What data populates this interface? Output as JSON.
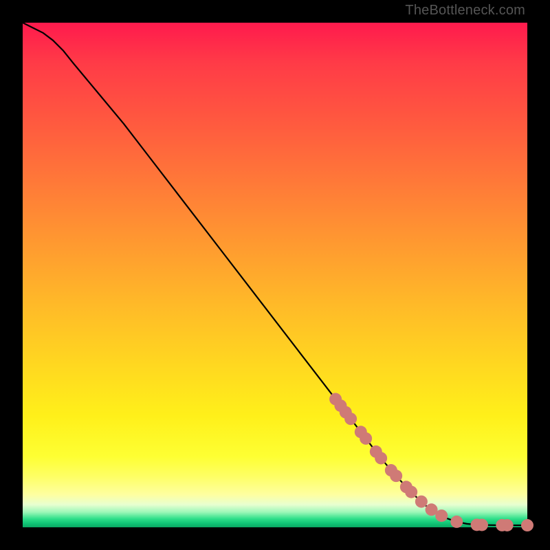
{
  "watermark": "TheBottleneck.com",
  "colors": {
    "curve": "#000000",
    "marker_fill": "#cf7a76",
    "marker_stroke": "#b86864"
  },
  "chart_data": {
    "type": "line",
    "title": "",
    "xlabel": "",
    "ylabel": "",
    "xlim": [
      0,
      100
    ],
    "ylim": [
      0,
      100
    ],
    "grid": false,
    "series": [
      {
        "name": "curve",
        "x": [
          0,
          2,
          4,
          6,
          8,
          10,
          15,
          20,
          25,
          30,
          35,
          40,
          45,
          50,
          55,
          60,
          62,
          64,
          66,
          68,
          70,
          72,
          74,
          76,
          78,
          80,
          82,
          84,
          86,
          88,
          90,
          92,
          94,
          96,
          98,
          100
        ],
        "y": [
          100,
          99,
          98,
          96.5,
          94.5,
          92,
          86,
          80,
          73.5,
          67,
          60.5,
          54,
          47.5,
          41,
          34.5,
          28,
          25.4,
          22.8,
          20.2,
          17.6,
          15,
          12.5,
          10.2,
          8.0,
          6.0,
          4.2,
          2.8,
          1.8,
          1.1,
          0.7,
          0.5,
          0.45,
          0.42,
          0.4,
          0.4,
          0.4
        ]
      }
    ],
    "markers": [
      {
        "x": 62,
        "y": 25.4
      },
      {
        "x": 63,
        "y": 24.1
      },
      {
        "x": 64,
        "y": 22.8
      },
      {
        "x": 65,
        "y": 21.5
      },
      {
        "x": 67,
        "y": 18.9
      },
      {
        "x": 68,
        "y": 17.6
      },
      {
        "x": 70,
        "y": 15.0
      },
      {
        "x": 71,
        "y": 13.7
      },
      {
        "x": 73,
        "y": 11.3
      },
      {
        "x": 74,
        "y": 10.2
      },
      {
        "x": 76,
        "y": 8.0
      },
      {
        "x": 77,
        "y": 7.0
      },
      {
        "x": 79,
        "y": 5.1
      },
      {
        "x": 81,
        "y": 3.5
      },
      {
        "x": 83,
        "y": 2.3
      },
      {
        "x": 86,
        "y": 1.1
      },
      {
        "x": 90,
        "y": 0.5
      },
      {
        "x": 91,
        "y": 0.48
      },
      {
        "x": 95,
        "y": 0.42
      },
      {
        "x": 96,
        "y": 0.41
      },
      {
        "x": 100,
        "y": 0.4
      }
    ]
  }
}
